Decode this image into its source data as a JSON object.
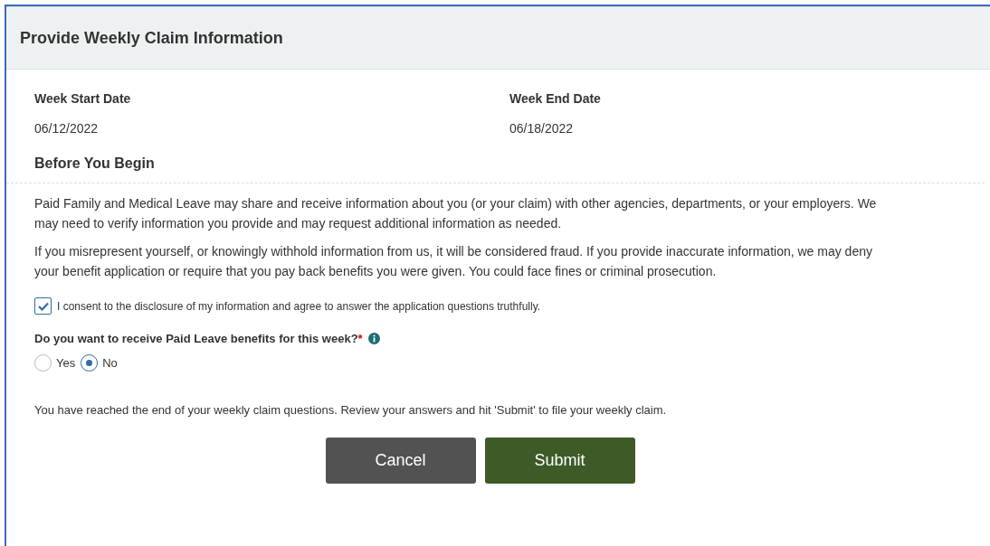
{
  "title": "Provide Weekly Claim Information",
  "dates": [
    {
      "label": "Week Start Date",
      "value": "06/12/2022"
    },
    {
      "label": "Week End Date",
      "value": "06/18/2022"
    }
  ],
  "section_title": "Before You Begin",
  "paragraphs": [
    "Paid Family and Medical Leave may share and receive information about you (or your claim) with other agencies, departments, or your employers. We may need to verify information you provide and may request additional information as needed.",
    "If you misrepresent yourself, or knowingly withhold information from us, it will be considered fraud. If you provide inaccurate information, we may deny your benefit application or require that you pay back benefits you were given. You could face fines or criminal prosecution."
  ],
  "consent": {
    "label": "I consent to the disclosure of my information and agree to answer the application questions truthfully.",
    "checked": true
  },
  "question": {
    "label": "Do you want to receive Paid Leave benefits for this week?",
    "required_mark": "*",
    "options": [
      {
        "label": "Yes",
        "selected": false
      },
      {
        "label": "No",
        "selected": true
      }
    ]
  },
  "end_note": "You have reached the end of your weekly claim questions. Review your answers and hit 'Submit' to file your weekly claim.",
  "buttons": [
    {
      "label": "Cancel",
      "kind": "secondary"
    },
    {
      "label": "Submit",
      "kind": "primary"
    }
  ]
}
